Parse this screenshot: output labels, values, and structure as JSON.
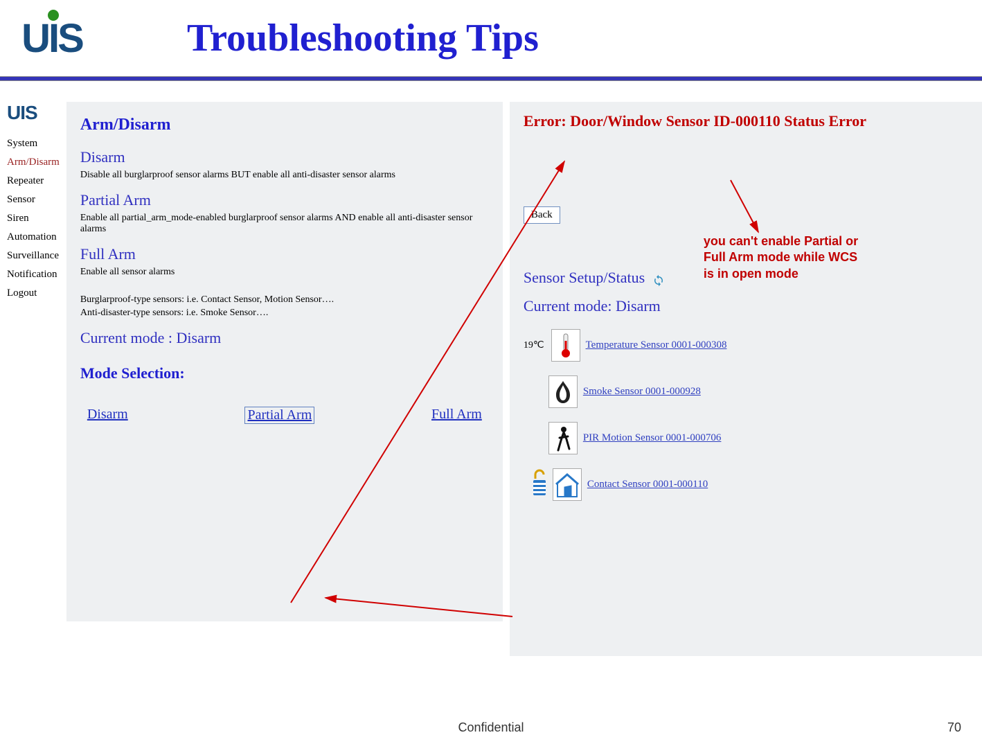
{
  "header": {
    "title": "Troubleshooting Tips",
    "logo_text": "UIS"
  },
  "nav": {
    "logo": "UIS",
    "items": [
      "System",
      "Arm/Disarm",
      "Repeater",
      "Sensor",
      "Siren",
      "Automation",
      "Surveillance",
      "Notification",
      "Logout"
    ],
    "active_index": 1
  },
  "left": {
    "title": "Arm/Disarm",
    "disarm_h": "Disarm",
    "disarm_d": "Disable all burglarproof sensor alarms BUT enable all anti-disaster sensor alarms",
    "partial_h": "Partial Arm",
    "partial_d": "Enable all partial_arm_mode-enabled burglarproof sensor alarms AND enable all anti-disaster sensor alarms",
    "full_h": "Full Arm",
    "full_d": "Enable all sensor alarms",
    "note1": "Burglarproof-type sensors: i.e. Contact Sensor, Motion Sensor….",
    "note2": "Anti-disaster-type sensors: i.e. Smoke Sensor….",
    "current_mode": "Current mode : Disarm",
    "mode_selection": "Mode Selection:",
    "links": {
      "disarm": "Disarm",
      "partial": "Partial Arm",
      "full": "Full Arm"
    }
  },
  "right": {
    "error": "Error: Door/Window Sensor ID-000110 Status Error",
    "back": "Back",
    "annotation": "you can't enable Partial or Full Arm mode while WCS is in open mode",
    "sensor_setup": "Sensor Setup/Status",
    "current_mode": "Current mode: Disarm",
    "temp_value": "19℃",
    "sensors": [
      {
        "icon": "thermometer",
        "label": "Temperature Sensor 0001-000308"
      },
      {
        "icon": "fire",
        "label": "Smoke Sensor 0001-000928"
      },
      {
        "icon": "motion",
        "label": "PIR Motion Sensor 0001-000706"
      },
      {
        "icon": "house-open",
        "label": "Contact Sensor 0001-000110"
      }
    ]
  },
  "footer": {
    "center": "Confidential",
    "page": "70"
  }
}
